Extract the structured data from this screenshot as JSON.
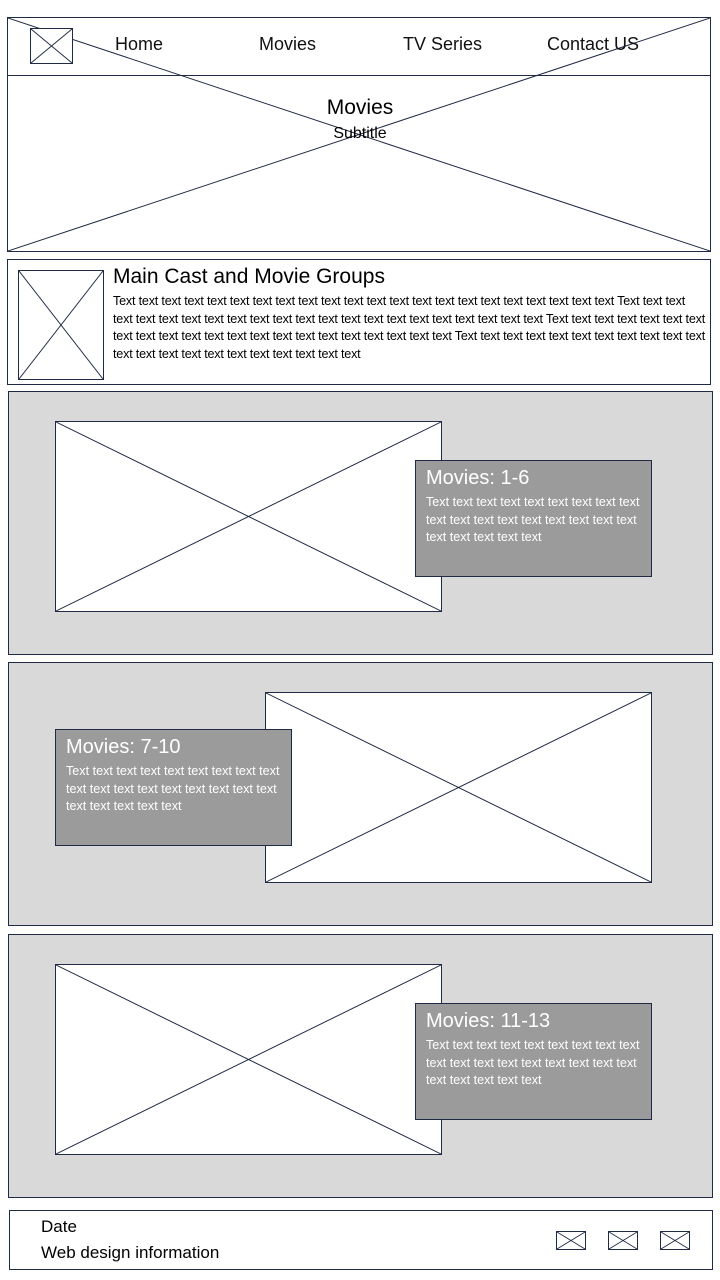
{
  "nav": {
    "items": [
      {
        "label": "Home"
      },
      {
        "label": "Movies"
      },
      {
        "label": "TV Series"
      },
      {
        "label": "Contact US"
      }
    ]
  },
  "hero": {
    "title": "Movies",
    "subtitle": "Subtitle"
  },
  "intro": {
    "heading": "Main Cast and Movie Groups",
    "text": "Text text text text text text text text text text text text text text text text text text text text text text Text text text text text text text text text text text text text text text text text text text text text text Text text text text text text text text text text text text text text text text text text text text text text Text text text text text text text text text text text text text text text text text text text text text text"
  },
  "sections": [
    {
      "title": "Movies: 1-6",
      "text": "Text text text text text text text text text text text text text text text text text text text text text text text"
    },
    {
      "title": "Movies: 7-10",
      "text": "Text text text text text text text text text text text text text text text text text text text text text text text"
    },
    {
      "title": "Movies: 11-13",
      "text": "Text text text text text text text text text text text text text text text text text text text text text text text"
    }
  ],
  "footer": {
    "date": "Date",
    "info": "Web design information"
  }
}
